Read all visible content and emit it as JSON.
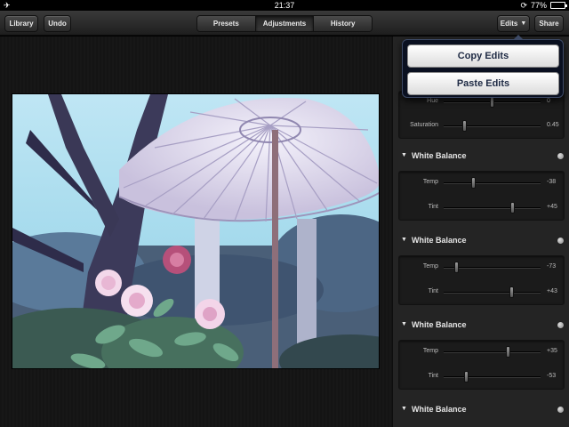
{
  "statusbar": {
    "time": "21:37",
    "battery": "77%",
    "battery_level": 0.77
  },
  "toolbar": {
    "library": "Library",
    "undo": "Undo",
    "tabs": [
      {
        "label": "Presets"
      },
      {
        "label": "Adjustments",
        "active": true
      },
      {
        "label": "History"
      }
    ],
    "edits": "Edits",
    "share": "Share"
  },
  "popover": {
    "copy": "Copy Edits",
    "paste": "Paste Edits"
  },
  "panel": {
    "color_section": {
      "rows": [
        {
          "label": "Hue",
          "value": "0",
          "pos": 0.5
        },
        {
          "label": "Saturation",
          "value": "0.45",
          "pos": 0.22
        }
      ]
    },
    "sections": [
      {
        "title": "White Balance",
        "rows": [
          {
            "label": "Temp",
            "value": "-38",
            "pos": 0.31
          },
          {
            "label": "Tint",
            "value": "+45",
            "pos": 0.72
          }
        ]
      },
      {
        "title": "White Balance",
        "rows": [
          {
            "label": "Temp",
            "value": "-73",
            "pos": 0.14
          },
          {
            "label": "Tint",
            "value": "+43",
            "pos": 0.71
          }
        ]
      },
      {
        "title": "White Balance",
        "rows": [
          {
            "label": "Temp",
            "value": "+35",
            "pos": 0.67
          },
          {
            "label": "Tint",
            "value": "-53",
            "pos": 0.24
          }
        ]
      },
      {
        "title": "White Balance",
        "rows": []
      }
    ]
  }
}
